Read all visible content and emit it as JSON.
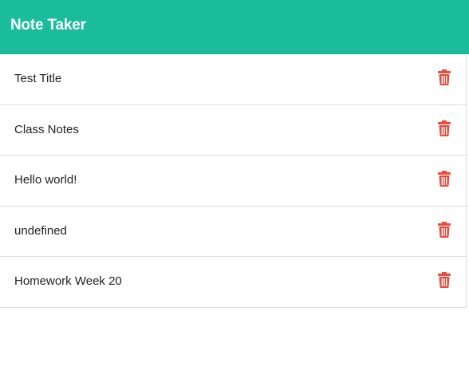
{
  "app": {
    "title": "Note Taker",
    "accent_color": "#1abc9c",
    "delete_color": "#e74c3c"
  },
  "notes": [
    {
      "title": "Test Title",
      "action_icon": "trash-icon"
    },
    {
      "title": "Class Notes",
      "action_icon": "trash-icon"
    },
    {
      "title": "Hello world!",
      "action_icon": "trash-icon"
    },
    {
      "title": "undefined",
      "action_icon": "trash-icon"
    },
    {
      "title": "Homework Week 20",
      "action_icon": "trash-icon"
    }
  ]
}
